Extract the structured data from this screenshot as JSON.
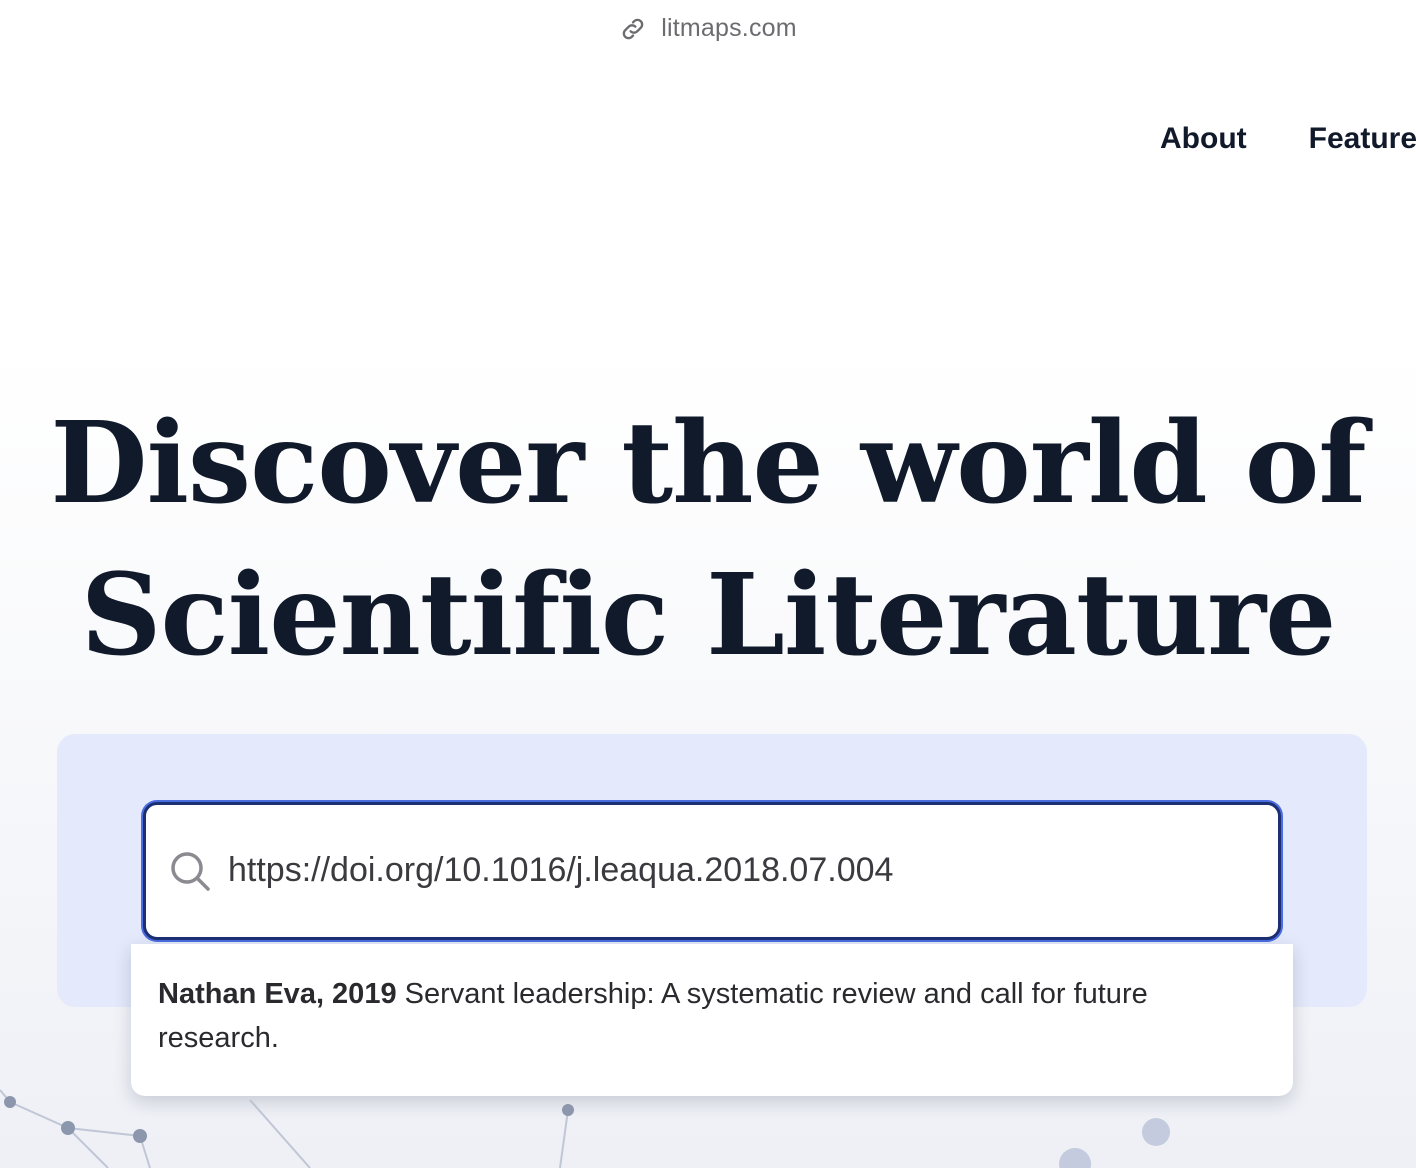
{
  "browser": {
    "url": "litmaps.com",
    "link_icon": "link-icon"
  },
  "nav": {
    "items": [
      {
        "label": "About"
      },
      {
        "label": "Features"
      }
    ]
  },
  "hero": {
    "line1": "Discover the world of",
    "line2": "Scientific Literature"
  },
  "search": {
    "icon": "search-icon",
    "value": "https://doi.org/10.1016/j.leaqua.2018.07.004",
    "focus_color": "#1d2f73",
    "panel_color": "#e4eafb"
  },
  "results": [
    {
      "author_year": "Nathan Eva, 2019",
      "title": "Servant leadership: A systematic review and call for future research."
    }
  ]
}
